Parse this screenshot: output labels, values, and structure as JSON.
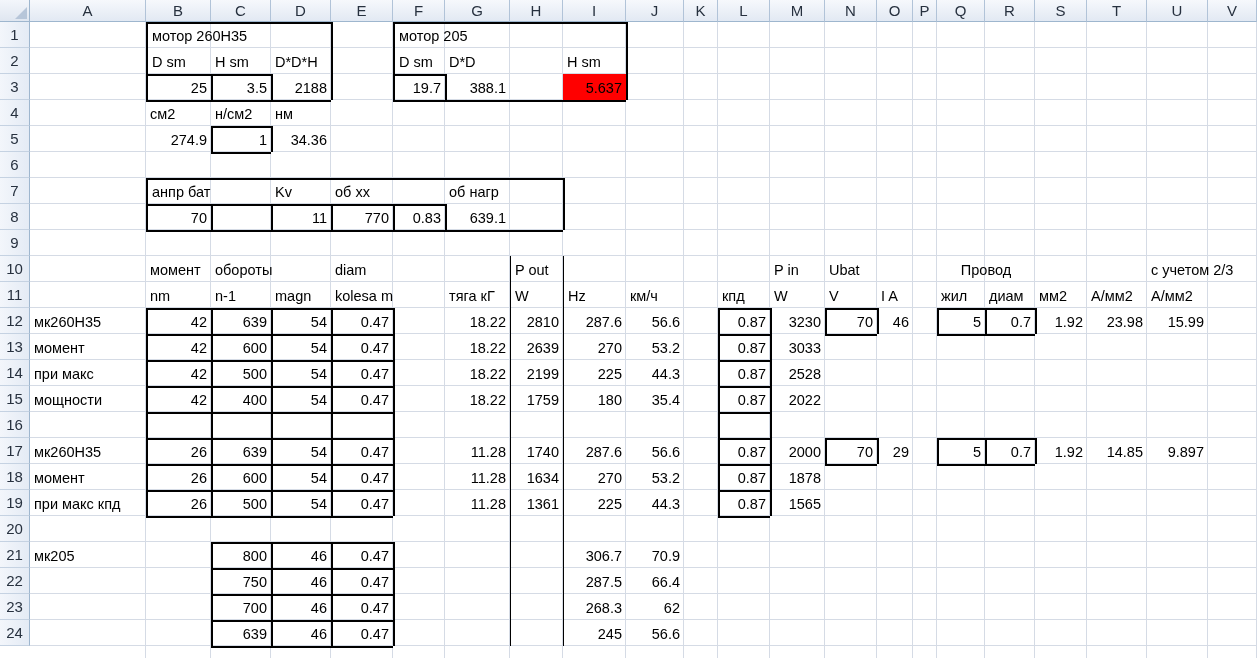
{
  "columns": [
    "A",
    "B",
    "C",
    "D",
    "E",
    "F",
    "G",
    "H",
    "I",
    "J",
    "K",
    "L",
    "M",
    "N",
    "O",
    "P",
    "Q",
    "R",
    "S",
    "T",
    "U",
    "V"
  ],
  "rows": [
    {
      "number": "1",
      "cells": [
        null,
        {
          "text": "мотор 260H35",
          "kind": "label"
        },
        null,
        null,
        null,
        {
          "text": "мотор 205",
          "kind": "label"
        }
      ]
    },
    {
      "number": "2",
      "cells": [
        null,
        {
          "text": "D sm",
          "kind": "label"
        },
        {
          "text": "H sm",
          "kind": "label"
        },
        {
          "text": "D*D*H",
          "kind": "label"
        },
        null,
        {
          "text": "D sm",
          "kind": "label"
        },
        {
          "text": "D*D",
          "kind": "label"
        },
        null,
        {
          "text": "H sm",
          "kind": "label"
        }
      ]
    },
    {
      "number": "3",
      "cells": [
        null,
        {
          "text": "25",
          "kind": "number"
        },
        {
          "text": "3.5",
          "kind": "number"
        },
        {
          "text": "2188",
          "kind": "number"
        },
        null,
        {
          "text": "19.7",
          "kind": "number"
        },
        {
          "text": "388.1",
          "kind": "number"
        },
        null,
        {
          "text": "5.637",
          "kind": "number",
          "color": "#ff0000"
        }
      ]
    },
    {
      "number": "4",
      "cells": [
        null,
        {
          "text": "см2",
          "kind": "label"
        },
        {
          "text": "н/см2",
          "kind": "label"
        },
        {
          "text": "нм",
          "kind": "label"
        }
      ]
    },
    {
      "number": "5",
      "cells": [
        null,
        {
          "text": "274.9",
          "kind": "number"
        },
        {
          "text": "1",
          "kind": "number"
        },
        {
          "text": "34.36",
          "kind": "number"
        }
      ]
    },
    {
      "number": "6"
    },
    {
      "number": "7",
      "cells": [
        null,
        {
          "text": "анпр бат",
          "kind": "label"
        },
        null,
        {
          "text": "Kv",
          "kind": "label"
        },
        {
          "text": "об хх",
          "kind": "label"
        },
        null,
        {
          "text": "об нагр",
          "kind": "label"
        }
      ]
    },
    {
      "number": "8",
      "cells": [
        null,
        {
          "text": "70",
          "kind": "number"
        },
        null,
        {
          "text": "11",
          "kind": "number"
        },
        {
          "text": "770",
          "kind": "number"
        },
        {
          "text": "0.83",
          "kind": "number"
        },
        {
          "text": "639.1",
          "kind": "number"
        }
      ]
    },
    {
      "number": "9"
    },
    {
      "number": "10",
      "cells": [
        null,
        {
          "text": "момент",
          "kind": "label"
        },
        {
          "text": "обороты",
          "kind": "label"
        },
        null,
        {
          "text": "diam",
          "kind": "label"
        },
        null,
        null,
        {
          "text": "P out",
          "kind": "label"
        },
        null,
        null,
        null,
        null,
        {
          "text": "P in",
          "kind": "label"
        },
        {
          "text": "Ubat",
          "kind": "label"
        },
        null,
        null,
        {
          "text": "Провод",
          "kind": "centered"
        },
        null,
        null,
        null,
        {
          "text": "с учетом 2/3",
          "kind": "label"
        }
      ]
    },
    {
      "number": "11",
      "cells": [
        null,
        {
          "text": "nm",
          "kind": "label"
        },
        {
          "text": "n-1",
          "kind": "label"
        },
        {
          "text": "magn",
          "kind": "label"
        },
        {
          "text": "kolesa m",
          "kind": "label"
        },
        null,
        {
          "text": "тяга кГ",
          "kind": "label"
        },
        {
          "text": "W",
          "kind": "label"
        },
        {
          "text": "Hz",
          "kind": "label"
        },
        {
          "text": "км/ч",
          "kind": "label"
        },
        null,
        {
          "text": "кпд",
          "kind": "label"
        },
        {
          "text": "W",
          "kind": "label"
        },
        {
          "text": "V",
          "kind": "label"
        },
        {
          "text": "I A",
          "kind": "label"
        },
        null,
        {
          "text": "жил",
          "kind": "label"
        },
        {
          "text": "диам",
          "kind": "label"
        },
        {
          "text": "мм2",
          "kind": "label"
        },
        {
          "text": "А/мм2",
          "kind": "label"
        },
        {
          "text": "А/мм2",
          "kind": "label"
        }
      ]
    },
    {
      "number": "12",
      "cells": [
        {
          "text": "мк260H35",
          "kind": "label"
        },
        {
          "text": "42",
          "kind": "number"
        },
        {
          "text": "639",
          "kind": "number"
        },
        {
          "text": "54",
          "kind": "number"
        },
        {
          "text": "0.47",
          "kind": "number"
        },
        null,
        {
          "text": "18.22",
          "kind": "number"
        },
        {
          "text": "2810",
          "kind": "number"
        },
        {
          "text": "287.6",
          "kind": "number"
        },
        {
          "text": "56.6",
          "kind": "number"
        },
        null,
        {
          "text": "0.87",
          "kind": "number"
        },
        {
          "text": "3230",
          "kind": "number"
        },
        {
          "text": "70",
          "kind": "number"
        },
        {
          "text": "46",
          "kind": "number"
        },
        null,
        {
          "text": "5",
          "kind": "number"
        },
        {
          "text": "0.7",
          "kind": "number"
        },
        {
          "text": "1.92",
          "kind": "number"
        },
        {
          "text": "23.98",
          "kind": "number"
        },
        {
          "text": "15.99",
          "kind": "number"
        }
      ]
    },
    {
      "number": "13",
      "cells": [
        {
          "text": "момент",
          "kind": "label"
        },
        {
          "text": "42",
          "kind": "number"
        },
        {
          "text": "600",
          "kind": "number"
        },
        {
          "text": "54",
          "kind": "number"
        },
        {
          "text": "0.47",
          "kind": "number"
        },
        null,
        {
          "text": "18.22",
          "kind": "number"
        },
        {
          "text": "2639",
          "kind": "number"
        },
        {
          "text": "270",
          "kind": "number"
        },
        {
          "text": "53.2",
          "kind": "number"
        },
        null,
        {
          "text": "0.87",
          "kind": "number"
        },
        {
          "text": "3033",
          "kind": "number"
        }
      ]
    },
    {
      "number": "14",
      "cells": [
        {
          "text": "при макс",
          "kind": "label"
        },
        {
          "text": "42",
          "kind": "number"
        },
        {
          "text": "500",
          "kind": "number"
        },
        {
          "text": "54",
          "kind": "number"
        },
        {
          "text": "0.47",
          "kind": "number"
        },
        null,
        {
          "text": "18.22",
          "kind": "number"
        },
        {
          "text": "2199",
          "kind": "number"
        },
        {
          "text": "225",
          "kind": "number"
        },
        {
          "text": "44.3",
          "kind": "number"
        },
        null,
        {
          "text": "0.87",
          "kind": "number"
        },
        {
          "text": "2528",
          "kind": "number"
        }
      ]
    },
    {
      "number": "15",
      "cells": [
        {
          "text": "мощности",
          "kind": "label"
        },
        {
          "text": "42",
          "kind": "number"
        },
        {
          "text": "400",
          "kind": "number"
        },
        {
          "text": "54",
          "kind": "number"
        },
        {
          "text": "0.47",
          "kind": "number"
        },
        null,
        {
          "text": "18.22",
          "kind": "number"
        },
        {
          "text": "1759",
          "kind": "number"
        },
        {
          "text": "180",
          "kind": "number"
        },
        {
          "text": "35.4",
          "kind": "number"
        },
        null,
        {
          "text": "0.87",
          "kind": "number"
        },
        {
          "text": "2022",
          "kind": "number"
        }
      ]
    },
    {
      "number": "16"
    },
    {
      "number": "17",
      "cells": [
        {
          "text": "мк260H35",
          "kind": "label"
        },
        {
          "text": "26",
          "kind": "number"
        },
        {
          "text": "639",
          "kind": "number"
        },
        {
          "text": "54",
          "kind": "number"
        },
        {
          "text": "0.47",
          "kind": "number"
        },
        null,
        {
          "text": "11.28",
          "kind": "number"
        },
        {
          "text": "1740",
          "kind": "number"
        },
        {
          "text": "287.6",
          "kind": "number"
        },
        {
          "text": "56.6",
          "kind": "number"
        },
        null,
        {
          "text": "0.87",
          "kind": "number"
        },
        {
          "text": "2000",
          "kind": "number"
        },
        {
          "text": "70",
          "kind": "number"
        },
        {
          "text": "29",
          "kind": "number"
        },
        null,
        {
          "text": "5",
          "kind": "number"
        },
        {
          "text": "0.7",
          "kind": "number"
        },
        {
          "text": "1.92",
          "kind": "number"
        },
        {
          "text": "14.85",
          "kind": "number"
        },
        {
          "text": "9.897",
          "kind": "number"
        }
      ]
    },
    {
      "number": "18",
      "cells": [
        {
          "text": "момент",
          "kind": "label"
        },
        {
          "text": "26",
          "kind": "number"
        },
        {
          "text": "600",
          "kind": "number"
        },
        {
          "text": "54",
          "kind": "number"
        },
        {
          "text": "0.47",
          "kind": "number"
        },
        null,
        {
          "text": "11.28",
          "kind": "number"
        },
        {
          "text": "1634",
          "kind": "number"
        },
        {
          "text": "270",
          "kind": "number"
        },
        {
          "text": "53.2",
          "kind": "number"
        },
        null,
        {
          "text": "0.87",
          "kind": "number"
        },
        {
          "text": "1878",
          "kind": "number"
        }
      ]
    },
    {
      "number": "19",
      "cells": [
        {
          "text": "при макс кпд",
          "kind": "label"
        },
        {
          "text": "26",
          "kind": "number"
        },
        {
          "text": "500",
          "kind": "number"
        },
        {
          "text": "54",
          "kind": "number"
        },
        {
          "text": "0.47",
          "kind": "number"
        },
        null,
        {
          "text": "11.28",
          "kind": "number"
        },
        {
          "text": "1361",
          "kind": "number"
        },
        {
          "text": "225",
          "kind": "number"
        },
        {
          "text": "44.3",
          "kind": "number"
        },
        null,
        {
          "text": "0.87",
          "kind": "number"
        },
        {
          "text": "1565",
          "kind": "number"
        }
      ]
    },
    {
      "number": "20"
    },
    {
      "number": "21",
      "cells": [
        {
          "text": "мк205",
          "kind": "label"
        },
        null,
        {
          "text": "800",
          "kind": "number"
        },
        {
          "text": "46",
          "kind": "number"
        },
        {
          "text": "0.47",
          "kind": "number"
        },
        null,
        null,
        null,
        {
          "text": "306.7",
          "kind": "number"
        },
        {
          "text": "70.9",
          "kind": "number"
        }
      ]
    },
    {
      "number": "22",
      "cells": [
        null,
        null,
        {
          "text": "750",
          "kind": "number"
        },
        {
          "text": "46",
          "kind": "number"
        },
        {
          "text": "0.47",
          "kind": "number"
        },
        null,
        null,
        null,
        {
          "text": "287.5",
          "kind": "number"
        },
        {
          "text": "66.4",
          "kind": "number"
        }
      ]
    },
    {
      "number": "23",
      "cells": [
        null,
        null,
        {
          "text": "700",
          "kind": "number"
        },
        {
          "text": "46",
          "kind": "number"
        },
        {
          "text": "0.47",
          "kind": "number"
        },
        null,
        null,
        null,
        {
          "text": "268.3",
          "kind": "number"
        },
        {
          "text": "62",
          "kind": "number"
        }
      ]
    },
    {
      "number": "24",
      "cells": [
        null,
        null,
        {
          "text": "639",
          "kind": "number"
        },
        {
          "text": "46",
          "kind": "number"
        },
        {
          "text": "0.47",
          "kind": "number"
        },
        null,
        null,
        null,
        {
          "text": "245",
          "kind": "number"
        },
        {
          "text": "56.6",
          "kind": "number"
        }
      ]
    }
  ]
}
